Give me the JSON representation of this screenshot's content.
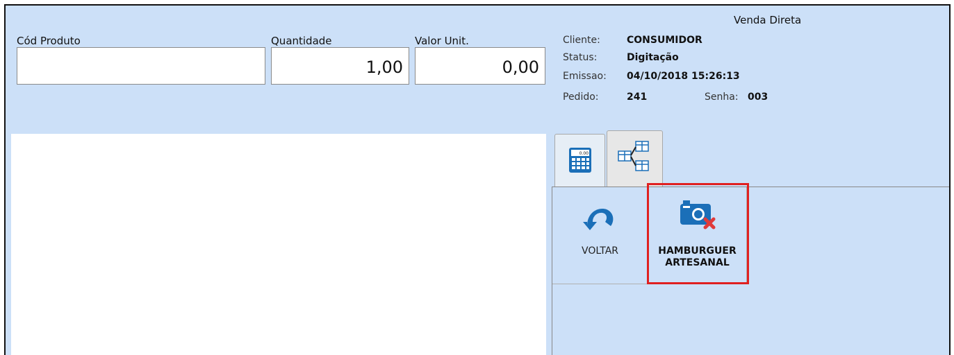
{
  "header": {
    "title": "Venda Direta"
  },
  "fields": {
    "cod_produto": {
      "label": "Cód Produto",
      "value": ""
    },
    "quantidade": {
      "label": "Quantidade",
      "value": "1,00"
    },
    "valor_unit": {
      "label": "Valor Unit.",
      "value": "0,00"
    }
  },
  "info": {
    "cliente_label": "Cliente:",
    "cliente_value": "CONSUMIDOR",
    "status_label": "Status:",
    "status_value": "Digitação",
    "emissao_label": "Emissao:",
    "emissao_value": "04/10/2018 15:26:13",
    "pedido_label": "Pedido:",
    "pedido_value": "241",
    "senha_label": "Senha:",
    "senha_value": "003"
  },
  "tabs": [
    {
      "icon": "calculator-icon",
      "calc_display": "0.00"
    },
    {
      "icon": "table-tree-icon"
    }
  ],
  "buttons": {
    "voltar_label": "VOLTAR",
    "hamburguer_line1": "HAMBURGUER",
    "hamburguer_line2": "ARTESANAL"
  },
  "colors": {
    "panel_bg": "#cce0f8",
    "highlight": "#e02020",
    "icon_blue": "#1b6fb8",
    "icon_red": "#e03a3a"
  }
}
